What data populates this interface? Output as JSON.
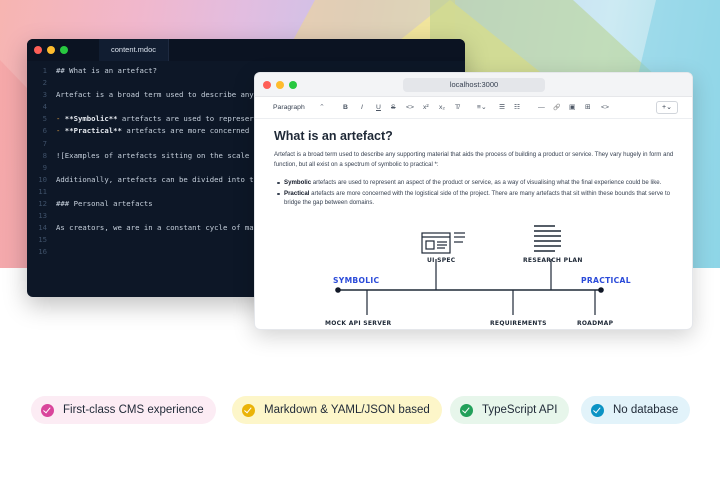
{
  "editor": {
    "tab_label": "content.mdoc",
    "lines": [
      {
        "num": "1",
        "text": "## What is an artefact?"
      },
      {
        "num": "2",
        "text": ""
      },
      {
        "num": "3",
        "text": "Artefact is a broad term used to describe any"
      },
      {
        "num": "4",
        "text": ""
      },
      {
        "num": "5",
        "pre": "- ",
        "bold": "**Symbolic**",
        "rest": " artefacts are used to represer"
      },
      {
        "num": "6",
        "pre": "- ",
        "bold": "**Practical**",
        "rest": " artefacts are more concerned"
      },
      {
        "num": "7",
        "text": ""
      },
      {
        "num": "8",
        "text": "![Examples of artefacts sitting on the scale"
      },
      {
        "num": "9",
        "text": ""
      },
      {
        "num": "10",
        "text": "Additionally, artefacts can be divided into t"
      },
      {
        "num": "11",
        "text": ""
      },
      {
        "num": "12",
        "text": "### Personal artefacts"
      },
      {
        "num": "13",
        "text": ""
      },
      {
        "num": "14",
        "text": "As creators, we are in a constant cycle of ma"
      },
      {
        "num": "15",
        "text": ""
      },
      {
        "num": "16",
        "text": ""
      }
    ]
  },
  "browser": {
    "url": "localhost:3000",
    "toolbar": {
      "paragraph_select": "Paragraph",
      "chevron": "⌃",
      "bold": "B",
      "italic": "I",
      "underline": "U",
      "strike": "S",
      "code": "<>",
      "superscript": "x²",
      "subscript": "x₂",
      "clear_format": "T̸",
      "align": "≡⌄",
      "bullet_list": "☰",
      "ordered_list": "☷",
      "divider": "—",
      "link": "🔗",
      "image": "▣",
      "table": "⊞",
      "code_block": "<>",
      "insert": "+⌄"
    },
    "document": {
      "heading": "What is an artefact?",
      "intro": "Artefact is a broad term used to describe any supporting material that aids the process of building a product or service. They vary hugely in form and function, but all exist on a spectrum of symbolic to practical *:",
      "bullets": [
        {
          "bold": "Symbolic",
          "rest": " artefacts are used to represent an aspect of the product or service, as a way of visualising what the final experience could be like."
        },
        {
          "bold": "Practical",
          "rest": " artefacts are more concerned with the logistical side of the project. There are many artefacts that sit within these bounds that serve to bridge the gap between domains."
        }
      ]
    },
    "diagram": {
      "left_label": "SYMBOLIC",
      "right_label": "PRACTICAL",
      "top_items": [
        "UI SPEC",
        "RESEARCH PLAN"
      ],
      "bottom_items": [
        "MOCK API SERVER",
        "REQUIREMENTS",
        "ROADMAP"
      ]
    }
  },
  "features": [
    {
      "label": "First-class CMS experience",
      "color": "#d9459b"
    },
    {
      "label": "Markdown & YAML/JSON based",
      "color": "#eab308"
    },
    {
      "label": "TypeScript API",
      "color": "#22a05a"
    },
    {
      "label": "No database",
      "color": "#0b93c4"
    }
  ]
}
